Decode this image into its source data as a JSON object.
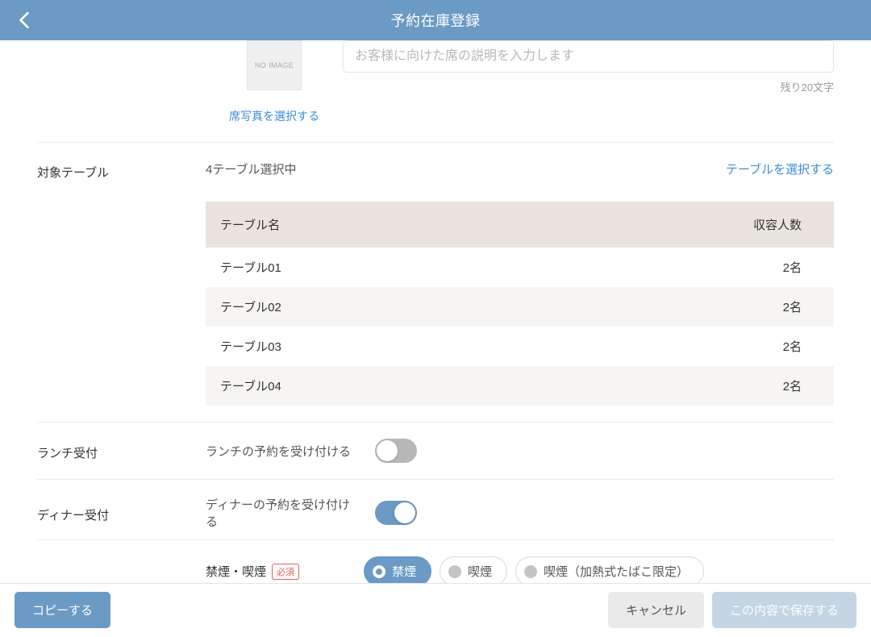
{
  "header": {
    "title": "予約在庫登録"
  },
  "photo": {
    "placeholder_label": "NO IMAGE",
    "link": "席写真を選択する"
  },
  "desc": {
    "placeholder": "お客様に向けた席の説明を入力します",
    "remaining": "残り20文字"
  },
  "tables": {
    "label": "対象テーブル",
    "count_text": "4テーブル選択中",
    "select_link": "テーブルを選択する",
    "col_name": "テーブル名",
    "col_capacity": "収容人数",
    "rows": [
      {
        "name": "テーブル01",
        "capacity": "2名"
      },
      {
        "name": "テーブル02",
        "capacity": "2名"
      },
      {
        "name": "テーブル03",
        "capacity": "2名"
      },
      {
        "name": "テーブル04",
        "capacity": "2名"
      }
    ]
  },
  "lunch": {
    "label": "ランチ受付",
    "text": "ランチの予約を受け付ける"
  },
  "dinner": {
    "label": "ディナー受付",
    "text": "ディナーの予約を受け付ける"
  },
  "smoking": {
    "label": "禁煙・喫煙",
    "required": "必須",
    "options": {
      "no": "禁煙",
      "yes": "喫煙",
      "heated": "喫煙（加熱式たばこ限定）"
    }
  },
  "footer": {
    "copy": "コピーする",
    "cancel": "キャンセル",
    "save": "この内容で保存する"
  }
}
